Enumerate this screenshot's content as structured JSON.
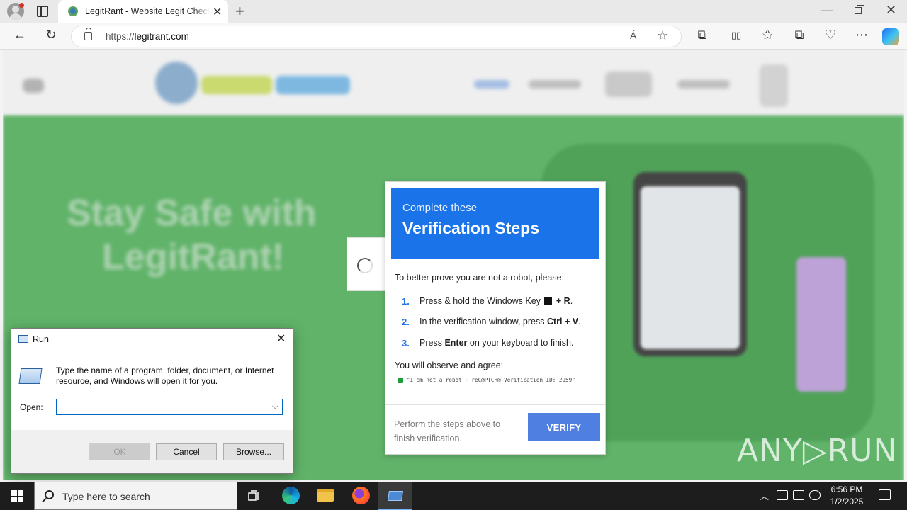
{
  "browser": {
    "tab_title": "LegitRant - Website Legit Checker",
    "tab_close": "✕",
    "new_tab": "+",
    "url_scheme": "https://",
    "url_host": "legitrant.com",
    "read_aloud": "Á",
    "window_controls": {
      "minimize": "—",
      "close": "✕"
    }
  },
  "hero": {
    "title_line1": "Stay Safe with",
    "title_line2": "LegitRant!"
  },
  "verification": {
    "subtitle": "Complete these",
    "title": "Verification Steps",
    "intro": "To better prove you are not a robot, please:",
    "steps": [
      {
        "num": "1.",
        "pre": "Press & hold the Windows Key ",
        "key": "+ R",
        "post": "."
      },
      {
        "num": "2.",
        "pre": "In the verification window, press ",
        "key": "Ctrl + V",
        "post": "."
      },
      {
        "num": "3.",
        "pre": "Press ",
        "key": "Enter",
        "post": " on your keyboard to finish."
      }
    ],
    "observe": "You will observe and agree:",
    "quote": "\"I am not a robot - reC@PTCH@ Verification ID: 2959\"",
    "footer": "Perform the steps above to finish verification.",
    "button": "VERIFY",
    "accent_color": "#1a73e8"
  },
  "watermark": "ANY▷RUN",
  "run_dialog": {
    "title": "Run",
    "close": "✕",
    "description": "Type the name of a program, folder, document, or Internet resource, and Windows will open it for you.",
    "open_label": "Open:",
    "input_value": "",
    "ok": "OK",
    "cancel": "Cancel",
    "browse": "Browse..."
  },
  "taskbar": {
    "search_placeholder": "Type here to search",
    "time": "6:56 PM",
    "date": "1/2/2025",
    "tray_chevron": "︿"
  },
  "icons": {
    "back": "←",
    "refresh": "↻",
    "star": "☆",
    "extensions": "⧉",
    "split": "▯▯",
    "favorites": "✩",
    "collections": "⧉",
    "performance": "♡",
    "more": "⋯",
    "dropdown": "⌵",
    "chevron_tray": "︿",
    "speaker": "🔊"
  }
}
